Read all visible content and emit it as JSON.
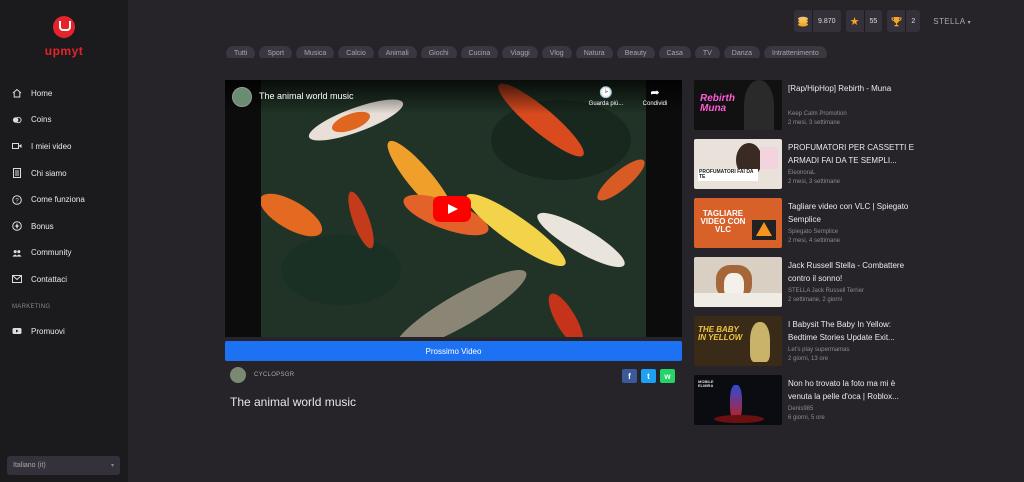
{
  "sidebar": {
    "logo_text": "upmyt",
    "items": [
      {
        "label": "Home",
        "icon": "home-icon"
      },
      {
        "label": "Coins",
        "icon": "coins-icon"
      },
      {
        "label": "I miei video",
        "icon": "video-icon"
      },
      {
        "label": "Chi siamo",
        "icon": "about-icon"
      },
      {
        "label": "Come funziona",
        "icon": "help-icon"
      },
      {
        "label": "Bonus",
        "icon": "bonus-icon"
      },
      {
        "label": "Community",
        "icon": "community-icon"
      },
      {
        "label": "Contattaci",
        "icon": "mail-icon"
      }
    ],
    "section_label": "MARKETING",
    "marketing_items": [
      {
        "label": "Promuovi",
        "icon": "youtube-icon"
      }
    ],
    "language": "Italiano (it)"
  },
  "topbar": {
    "coins": "9.870",
    "stars": "55",
    "trophies": "2",
    "username": "STELLA"
  },
  "categories": [
    "Tutti",
    "Sport",
    "Musica",
    "Calcio",
    "Animali",
    "Giochi",
    "Cucina",
    "Viaggi",
    "Vlog",
    "Natura",
    "Beauty",
    "Casa",
    "TV",
    "Danza",
    "Intrattenimento"
  ],
  "player": {
    "title": "The animal world music",
    "watch_later": "Guarda più...",
    "share": "Condividi"
  },
  "next_button": "Prossimo Video",
  "owner": "CYCLOPSGR",
  "video_title": "The animal world music",
  "share_buttons": [
    "f",
    "t",
    "w"
  ],
  "colors": {
    "accent": "#1d72f3",
    "brand": "#e3242b",
    "facebook": "#3b5998",
    "twitter": "#1da1f2",
    "whatsapp": "#25d366"
  },
  "related": [
    {
      "title": "[Rap/HipHop] Rebirth - Muna",
      "channel": "Keep Calm Promotion",
      "date": "2 mesi, 3 settimane",
      "thumb_text": "Rebirth Muna"
    },
    {
      "title": "PROFUMATORI PER CASSETTI E ARMADI FAI DA TE SEMPLI...",
      "channel": "EleonoraL",
      "date": "2 mesi, 3 settimane",
      "thumb_text": "PROFUMATORI FAI DA TE"
    },
    {
      "title": "Tagliare video con VLC | Spiegato Semplice",
      "channel": "Spiegato Semplice",
      "date": "2 mesi, 4 settimane",
      "thumb_text": "TAGLIARE VIDEO CON VLC"
    },
    {
      "title": "Jack Russell Stella - Combattere contro il sonno!",
      "channel": "STELLA Jack Russell Terrier",
      "date": "2 settimane, 2 giorni",
      "thumb_text": ""
    },
    {
      "title": "I Babysit The Baby In Yellow: Bedtime Stories Update Exit...",
      "channel": "Let's play supermamas",
      "date": "2 giorni, 13 ore",
      "thumb_text": "THE BABY IN YELLOW"
    },
    {
      "title": "Non ho trovato la foto ma mi è venuta la pelle d'oca | Roblox...",
      "channel": "Denis985",
      "date": "6 giorni, 5 ore",
      "thumb_text": "MOBILE ELMIRA"
    }
  ]
}
